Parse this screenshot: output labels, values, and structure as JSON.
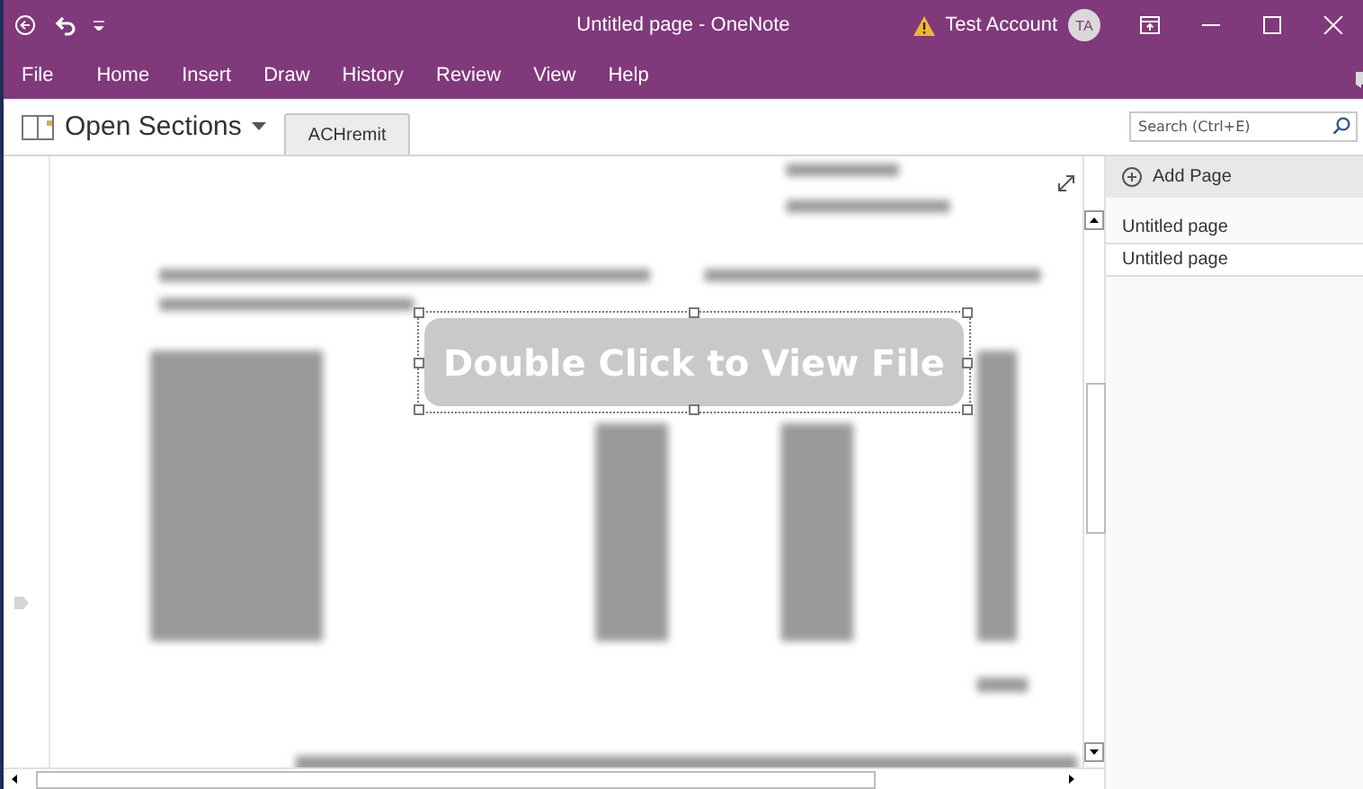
{
  "window": {
    "title": "Untitled page - OneNote",
    "account": "Test Account",
    "avatar_initials": "TA"
  },
  "ribbon_tabs": [
    {
      "label": "File"
    },
    {
      "label": "Home"
    },
    {
      "label": "Insert"
    },
    {
      "label": "Draw"
    },
    {
      "label": "History"
    },
    {
      "label": "Review"
    },
    {
      "label": "View"
    },
    {
      "label": "Help"
    }
  ],
  "notebook": {
    "label": "Open Sections",
    "sections": [
      {
        "label": "ACHremit",
        "selected": true
      }
    ]
  },
  "search": {
    "placeholder": "Search (Ctrl+E)"
  },
  "canvas": {
    "overlay_button": "Double Click to View File"
  },
  "pages": {
    "add_label": "Add Page",
    "items": [
      {
        "label": "Untitled page",
        "selected": false
      },
      {
        "label": "Untitled page",
        "selected": true
      }
    ]
  }
}
